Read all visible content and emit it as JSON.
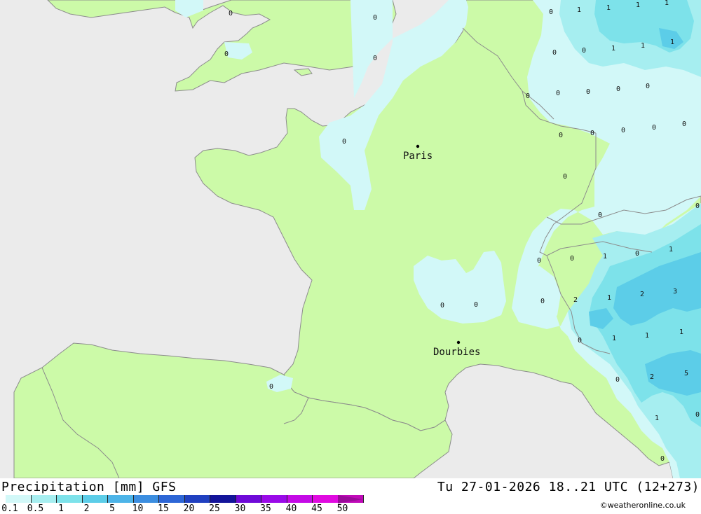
{
  "title": "Precipitation [mm] GFS",
  "datetime": "Tu 27-01-2026 18..21 UTC (12+273)",
  "credit": "©weatheronline.co.uk",
  "colors": {
    "sea": "#ebebeb",
    "land": "#ccfaa8",
    "precip_0_1": "#d2f8f8",
    "precip_0_5": "#a6eef0",
    "precip_1": "#7de2ea",
    "precip_2": "#5ccde8",
    "border": "#8c8c8c"
  },
  "legend": {
    "labels": [
      "0.1",
      "0.5",
      "1",
      "2",
      "5",
      "10",
      "15",
      "20",
      "25",
      "30",
      "35",
      "40",
      "45",
      "50"
    ],
    "colors": [
      "#d2f8f8",
      "#a6eef0",
      "#7de2ea",
      "#5ccde8",
      "#4db4e8",
      "#3c8ee0",
      "#2d66d6",
      "#2040c0",
      "#13149a",
      "#6f0ad8",
      "#9a0ae8",
      "#c40ae6",
      "#e00ae0",
      "#c00ab8"
    ]
  },
  "cities": [
    {
      "name": "Paris"
    },
    {
      "name": "Dourbies"
    }
  ],
  "values": [
    "0",
    "0",
    "0",
    "0",
    "0",
    "0",
    "0",
    "0",
    "0",
    "0",
    "0",
    "0",
    "1",
    "1",
    "1",
    "1",
    "1",
    "1",
    "1",
    "0",
    "0",
    "0",
    "0",
    "0",
    "0",
    "0",
    "0",
    "0",
    "0",
    "0",
    "0",
    "0",
    "0",
    "1",
    "0",
    "1",
    "0",
    "0",
    "0",
    "2",
    "1",
    "2",
    "3",
    "0",
    "1",
    "1",
    "1",
    "0",
    "2",
    "5",
    "1",
    "0",
    "0"
  ]
}
